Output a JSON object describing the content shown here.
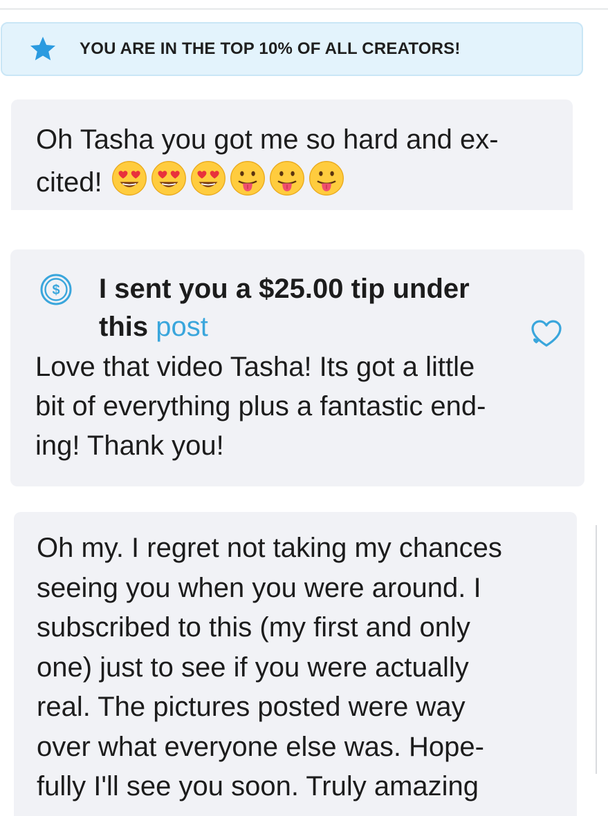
{
  "banner": {
    "icon": "star-icon",
    "text": "YOU ARE IN THE TOP 10% OF ALL CREATORS!",
    "accent": "#2b9be0"
  },
  "messages": [
    {
      "lines": [
        "Oh Tasha you got me so hard and ex-",
        "cited!"
      ],
      "emojis": [
        "heart-eyes-emoji",
        "heart-eyes-emoji",
        "heart-eyes-emoji",
        "tongue-out-emoji",
        "tongue-out-emoji",
        "tongue-out-emoji"
      ]
    },
    {
      "tip": {
        "icon": "dollar-icon",
        "line1": "I sent you a $25.00 tip under",
        "line2_prefix": "this ",
        "link": "post"
      },
      "lines": [
        "Love that video Tasha! Its got a little",
        "bit of everything plus a fantastic end-",
        "ing! Thank you!"
      ],
      "reaction_icon": "heart-icon",
      "link_color": "#3aa6dc"
    },
    {
      "lines": [
        "Oh my. I regret not taking my chances",
        "seeing you when you were around. I",
        "subscribed to this (my first and only",
        "one) just to see if you were actually",
        "real. The pictures posted were way",
        "over what everyone else was. Hope-",
        "fully I'll see you soon. Truly amazing"
      ]
    }
  ],
  "colors": {
    "bubble_bg": "#f1f2f6",
    "banner_bg": "#e3f3fc"
  }
}
